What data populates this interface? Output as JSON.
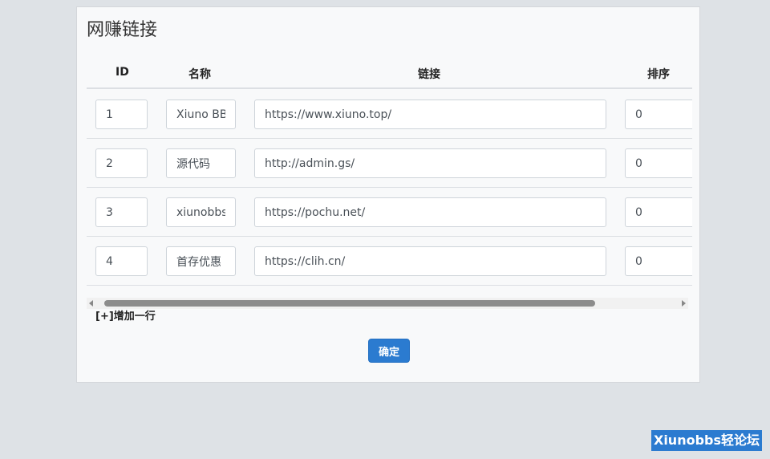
{
  "card": {
    "title": "网赚链接",
    "headers": {
      "id": "ID",
      "name": "名称",
      "link": "链接",
      "order": "排序"
    },
    "rows": [
      {
        "id": "1",
        "name": "Xiuno BBS",
        "link": "https://www.xiuno.top/",
        "order": "0"
      },
      {
        "id": "2",
        "name": "源代码",
        "link": "http://admin.gs/",
        "order": "0"
      },
      {
        "id": "3",
        "name": "xiunobbs",
        "link": "https://pochu.net/",
        "order": "0"
      },
      {
        "id": "4",
        "name": "首存优惠",
        "link": "https://clih.cn/",
        "order": "0"
      }
    ],
    "add_row_label": "[+]增加一行",
    "confirm_label": "确定"
  },
  "watermark": "Xiunobbs轻论坛",
  "colors": {
    "accent": "#2b7bd0",
    "background": "#dee2e6",
    "card": "#f8f9fa"
  }
}
